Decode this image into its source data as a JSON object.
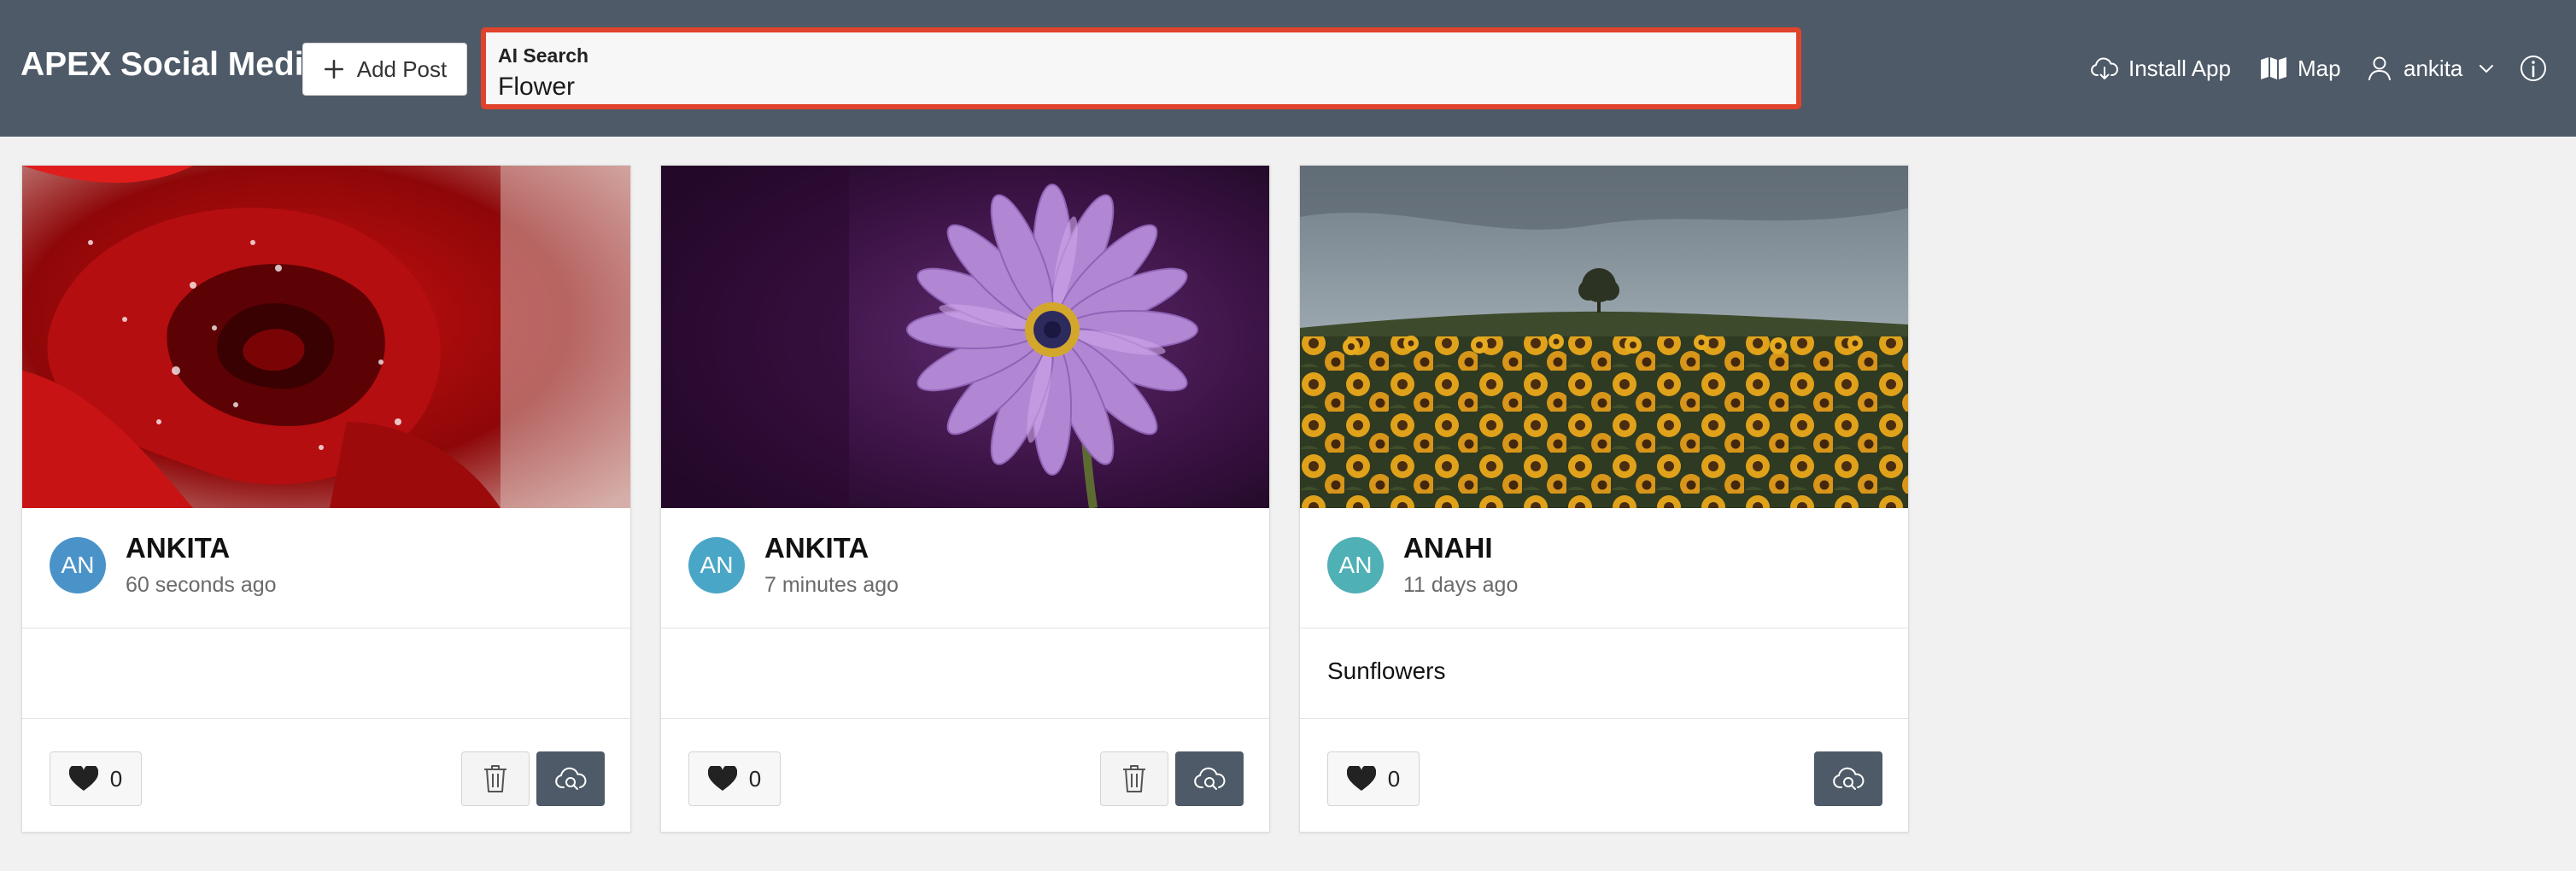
{
  "header": {
    "app_title": "APEX Social Media",
    "add_post_label": "Add Post",
    "search_label": "AI Search",
    "search_value": "Flower",
    "install_app_label": "Install App",
    "map_label": "Map",
    "user_label": "ankita"
  },
  "colors": {
    "header_bg": "#4e5a67",
    "search_border": "#e0432b",
    "avatar_ankita": "#4a93c9",
    "avatar_anahi": "#4fb0b5",
    "download_button": "#4e5a67"
  },
  "posts": [
    {
      "image": "red-rose-with-water-drops",
      "initials": "AN",
      "author": "ANKITA",
      "time": "60 seconds ago",
      "caption": "",
      "likes": "0",
      "can_delete": true
    },
    {
      "image": "purple-daisy-flower",
      "initials": "AN",
      "author": "ANKITA",
      "time": "7 minutes ago",
      "caption": "",
      "likes": "0",
      "can_delete": true
    },
    {
      "image": "sunflower-field-with-tree",
      "initials": "AN",
      "author": "ANAHI",
      "time": "11 days ago",
      "caption": "Sunflowers",
      "likes": "0",
      "can_delete": false
    }
  ]
}
